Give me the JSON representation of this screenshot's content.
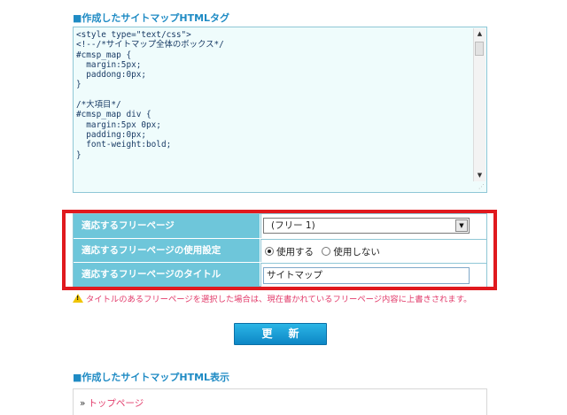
{
  "sections": {
    "html_tag_title": "■作成したサイトマップHTMLタグ",
    "html_view_title": "■作成したサイトマップHTML表示"
  },
  "code": {
    "lines": [
      "<style type=\"text/css\">",
      "<!--/*サイトマップ全体のボックス*/",
      "#cmsp_map {",
      "  margin:5px;",
      "  paddong:0px;",
      "}",
      "",
      "/*大項目*/",
      "#cmsp_map div {",
      "  margin:5px 0px;",
      "  padding:0px;",
      "  font-weight:bold;",
      "}"
    ]
  },
  "settings": {
    "rows": [
      {
        "label": "適応するフリーページ",
        "select_value": "(フリー 1)"
      },
      {
        "label": "適応するフリーページの使用設定",
        "radio_use": "使用する",
        "radio_nouse": "使用しない",
        "selected": "use"
      },
      {
        "label": "適応するフリーページのタイトル",
        "input_value": "サイトマップ"
      }
    ]
  },
  "warning": "タイトルのあるフリーページを選択した場合は、現在書かれているフリーページ内容に上書きされます。",
  "update_button": "更新",
  "view": {
    "chevron": "»",
    "link": "トップページ"
  },
  "colors": {
    "accent": "#1f8bc4",
    "label_bg": "#6ec6da",
    "highlight_frame": "#e0191e",
    "warning_text": "#e23c6b"
  }
}
